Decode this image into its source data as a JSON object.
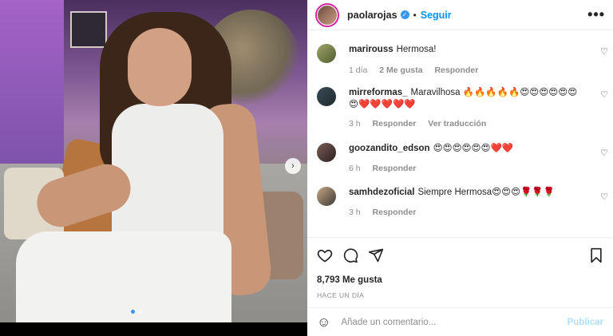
{
  "header": {
    "username": "paolarojas",
    "separator": "•",
    "follow_label": "Seguir",
    "more_label": "•••"
  },
  "photo": {
    "next_label": "›"
  },
  "comments": [
    {
      "user": "marirouss",
      "text": "Hermosa!",
      "time": "1 día",
      "likes": "2 Me gusta",
      "reply": "Responder",
      "extra": ""
    },
    {
      "user": "mirreformas_",
      "text": "Maravilhosa 🔥🔥🔥🔥🔥😍😍😍😍😍😍😍❤️❤️❤️❤️❤️",
      "time": "3 h",
      "likes": "",
      "reply": "Responder",
      "extra": "Ver traducción"
    },
    {
      "user": "goozandito_edson",
      "text": "😍😍😍😍😍😍❤️❤️",
      "time": "6 h",
      "likes": "",
      "reply": "Responder",
      "extra": ""
    },
    {
      "user": "samhdezoficial",
      "text": "Siempre Hermosa😍😍😍🌹🌹🌹",
      "time": "3 h",
      "likes": "",
      "reply": "Responder",
      "extra": ""
    }
  ],
  "post": {
    "likes": "8,793 Me gusta",
    "timestamp": "HACE UN DÍA"
  },
  "composer": {
    "placeholder": "Añade un comentario...",
    "post_label": "Publicar"
  },
  "colors": {
    "accent": "#0095f6",
    "verified": "#3897f0",
    "muted": "#8e8e8e"
  }
}
